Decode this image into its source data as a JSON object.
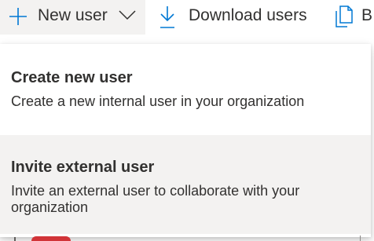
{
  "toolbar": {
    "new_user_label": "New user",
    "download_users_label": "Download users",
    "partial_button_label": "B",
    "icons": {
      "new_user": "plus-icon",
      "new_user_dropdown": "chevron-down-icon",
      "download": "download-arrow-icon",
      "partial": "document-copy-icon"
    }
  },
  "menu": {
    "items": [
      {
        "title": "Create new user",
        "description": "Create a new internal user in your organization"
      },
      {
        "title": "Invite external user",
        "description": "Invite an external user to collaborate with your organization"
      }
    ]
  },
  "colors": {
    "accent": "#0078d4",
    "text": "#323130",
    "hover_background": "#f3f2f1",
    "peek_red": "#d13438"
  }
}
